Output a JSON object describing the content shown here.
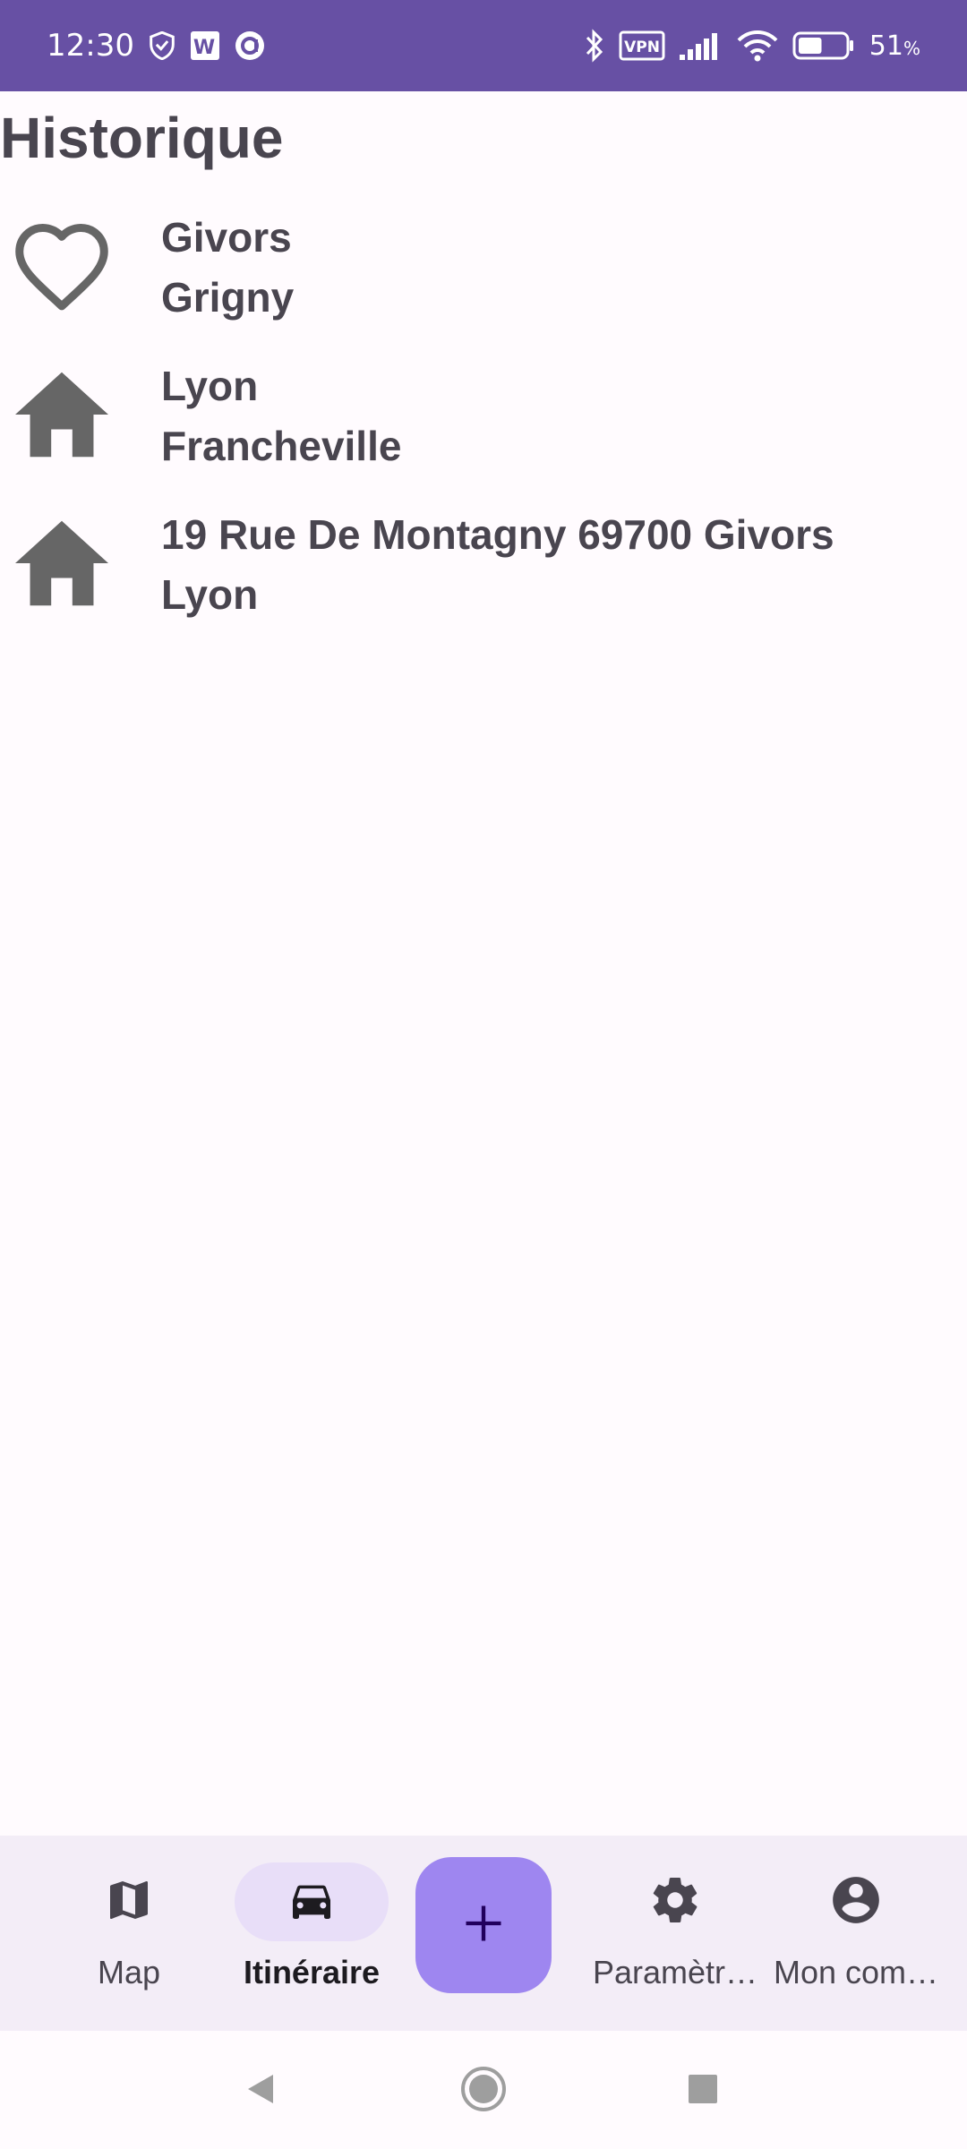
{
  "status_bar": {
    "time": "12:30",
    "vpn_label": "VPN",
    "battery_percent": "51",
    "battery_unit": "%",
    "battery_level": 0.51,
    "icons": [
      "shield-icon",
      "w-badge-icon",
      "a-circle-icon",
      "bluetooth-icon",
      "vpn-icon",
      "signal-icon",
      "wifi-icon",
      "battery-icon"
    ]
  },
  "page": {
    "title": "Historique"
  },
  "history": [
    {
      "icon": "heart-icon",
      "from": "Givors",
      "to": "Grigny"
    },
    {
      "icon": "home-icon",
      "from": "Lyon",
      "to": "Francheville"
    },
    {
      "icon": "home-icon",
      "from": "19 Rue De Montagny 69700 Givors",
      "to": "Lyon"
    }
  ],
  "bottom_nav": {
    "items": [
      {
        "label": "Map",
        "icon": "map-icon"
      },
      {
        "label": "Itinéraire",
        "icon": "car-icon",
        "active": true
      },
      {
        "label": "Paramètr…",
        "icon": "gear-icon"
      },
      {
        "label": "Mon com…",
        "icon": "account-circle-icon"
      }
    ],
    "fab_icon": "plus-icon"
  },
  "colors": {
    "status_bar": "#6750a4",
    "background": "#fffbfe",
    "nav_background": "#f3edf7",
    "nav_active_pill": "#e8def8",
    "fab": "#9e86f0",
    "icon_gray": "#666666",
    "text": "#49454f"
  }
}
